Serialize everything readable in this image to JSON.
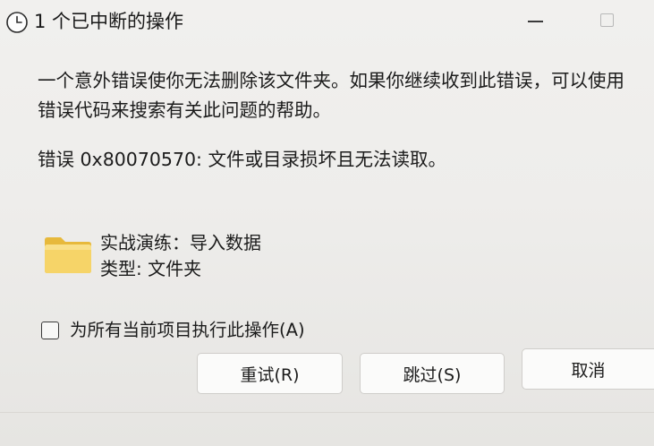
{
  "window": {
    "title": "1 个已中断的操作",
    "title_icon": "clock-icon",
    "controls": [
      "minimize-icon",
      "maximize-icon"
    ]
  },
  "message": {
    "line1": "一个意外错误使你无法删除该文件夹。如果你继续收到此错误，可以使用",
    "line2": "错误代码来搜索有关此问题的帮助。"
  },
  "error": {
    "text": "错误 0x80070570: 文件或目录损坏且无法读取。"
  },
  "item": {
    "icon": "folder-icon",
    "name": "实战演练：导入数据",
    "type": "类型: 文件夹"
  },
  "apply_all": {
    "label": "为所有当前项目执行此操作(A)",
    "checked": false
  },
  "buttons": {
    "retry": "重试(R)",
    "skip": "跳过(S)",
    "cancel": "取消"
  },
  "colors": {
    "background": "#efeeec",
    "text": "#1c1c1c",
    "folder": "#f3cf5e",
    "button_bg": "#fbfbfa",
    "button_border": "#cfcdca"
  }
}
